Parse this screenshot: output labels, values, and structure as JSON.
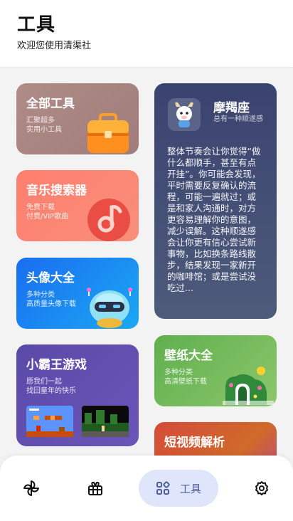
{
  "header": {
    "title": "工具",
    "subtitle": "欢迎您使用清渠社"
  },
  "cards": {
    "all_tools": {
      "title": "全部工具",
      "desc": "汇聚超多\n实用小工具"
    },
    "music": {
      "title": "音乐搜索器",
      "desc": "免费下载\n付费/VIP歌曲"
    },
    "avatar": {
      "title": "头像大全",
      "desc": "多种分类\n高质量头像下载"
    },
    "game": {
      "title": "小霸王游戏",
      "desc": "愿我们一起\n找回童年的快乐"
    },
    "horoscope": {
      "title": "摩羯座",
      "subtitle": "总有一种顺遂感",
      "body": "整体节奏会让你觉得“做什么都顺手，甚至有点开挂”。你可能会发现，平时需要反复确认的流程，可能一遍就过；或是和家人沟通时，对方更容易理解你的意图，减少误解。这种顺遂感会让你更有信心尝试新事物，比如换条路线散步，结果发现一家新开的咖啡馆；或是尝试没吃过..."
    },
    "wallpaper": {
      "title": "壁纸大全",
      "desc": "多种分类\n高清壁纸下载"
    },
    "video": {
      "title": "短视频解析"
    }
  },
  "nav": {
    "items": [
      {
        "name": "pinwheel-icon"
      },
      {
        "name": "gift-icon"
      },
      {
        "name": "tools-grid-icon",
        "label": "工具",
        "active": true
      },
      {
        "name": "gear-icon"
      }
    ]
  },
  "colors": {
    "nav_active_bg": "#dfe6fb",
    "nav_active_fg": "#4e5f9c"
  }
}
